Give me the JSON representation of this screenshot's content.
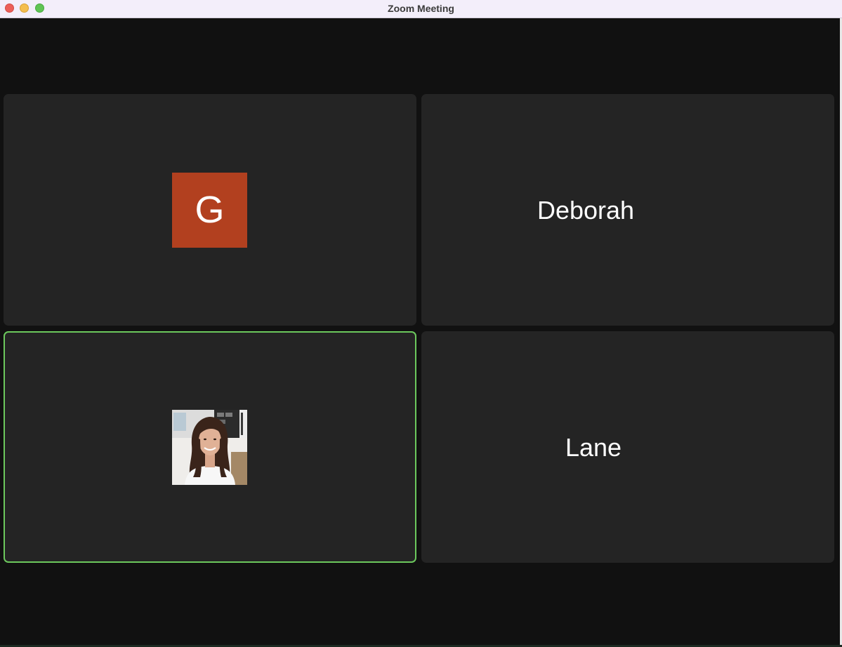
{
  "window": {
    "title": "Zoom Meeting"
  },
  "participants": [
    {
      "type": "initial",
      "initial": "G",
      "avatar_color": "#b2401f"
    },
    {
      "type": "name",
      "name": "Deborah"
    },
    {
      "type": "photo",
      "active_speaker": true,
      "highlight_color": "#6cc95d"
    },
    {
      "type": "name",
      "name": "Lane"
    }
  ],
  "colors": {
    "background": "#111111",
    "tile": "#242424",
    "titlebar": "#f3eefa"
  }
}
